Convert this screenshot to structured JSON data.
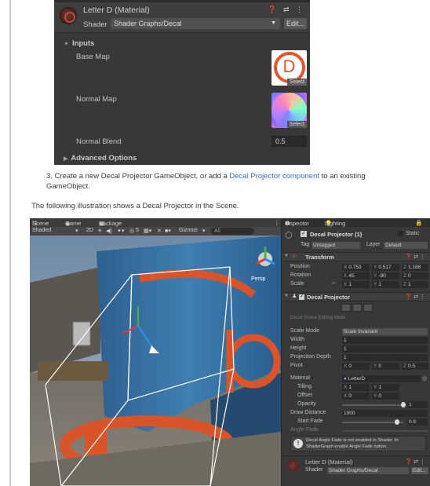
{
  "material_inspector": {
    "title": "Letter D (Material)",
    "shader_label": "Shader",
    "shader_value": "Shader Graphs/Decal",
    "edit_label": "Edit...",
    "inputs_label": "Inputs",
    "base_map_label": "Base Map",
    "normal_map_label": "Normal Map",
    "normal_blend_label": "Normal Blend",
    "normal_blend_value": "0.5",
    "select_label": "Select",
    "base_map_letter": "D",
    "advanced_label": "Advanced Options",
    "header_icons": "❓ ⇄ ⋮"
  },
  "step": {
    "number": "3.",
    "text_before": "Create a new Decal Projector GameObject, or add a ",
    "link": "Decal Projector component",
    "text_after": " to an existing GameObject."
  },
  "caption": "The following illustration shows a Decal Projector in the Scene.",
  "scene": {
    "tabs": [
      "Scene",
      "Game",
      "Package Manager"
    ],
    "shading": "Shaded",
    "toolbar_2d": "2D",
    "gizmos": "Gizmos",
    "search_all": "All",
    "persp_label": "Persp",
    "toolbar_count": "5"
  },
  "inspector": {
    "tabs": [
      "Inspector",
      "Lighting"
    ],
    "object_name": "Decal Projector (1)",
    "static_label": "Static",
    "tag_label": "Tag",
    "tag_value": "Untagged",
    "layer_label": "Layer",
    "layer_value": "Default",
    "transform": {
      "title": "Transform",
      "position_label": "Position",
      "position": [
        "0.753",
        "0.517",
        "1.188"
      ],
      "rotation_label": "Rotation",
      "rotation": [
        "45",
        "-90",
        "0"
      ],
      "scale_label": "Scale",
      "scale": [
        "1",
        "1",
        "1"
      ]
    },
    "decal": {
      "title": "Decal Projector",
      "editing_mode": "Decal Scene Editing Mode",
      "scale_mode_label": "Scale Mode",
      "scale_mode": "Scale Invariant",
      "width_label": "Width",
      "width": "1",
      "height_label": "Height",
      "height": "1",
      "depth_label": "Projection Depth",
      "depth": "1",
      "pivot_label": "Pivot",
      "pivot": [
        "0",
        "0",
        "0.5"
      ],
      "material_label": "Material",
      "material": "LetterD",
      "tiling_label": "Tilling",
      "tiling": [
        "1",
        "1"
      ],
      "offset_label": "Offset",
      "offset": [
        "0",
        "0"
      ],
      "opacity_label": "Opacity",
      "opacity": "1",
      "draw_distance_label": "Draw Distance",
      "draw_distance": "1000",
      "start_fade_label": "Start Fade",
      "start_fade": "0.9",
      "angle_fade_label": "Angle Fade",
      "warning": "Decal Angle Fade is not enabled in Shader. In ShaderGraph enable Angle Fade option."
    },
    "material_footer": {
      "title": "Letter D (Material)",
      "shader_label": "Shader",
      "shader_value": "Shader Graphs/Decal",
      "edit_label": "Edit..."
    }
  },
  "colors": {
    "editor_bg": "#383838",
    "decal_orange": "#e8552a",
    "link_blue": "#3a6bd6"
  }
}
